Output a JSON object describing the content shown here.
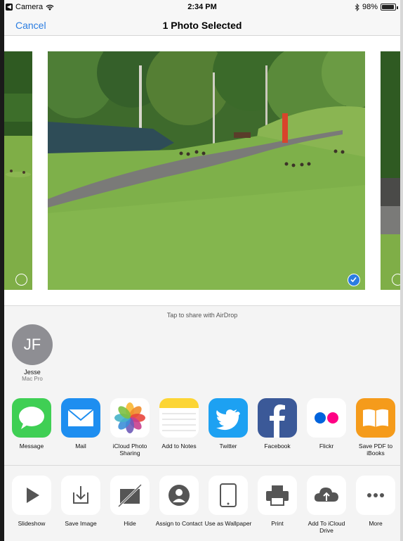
{
  "status": {
    "back_app": "Camera",
    "time": "2:34 PM",
    "battery": "98%",
    "battery_level": 0.98
  },
  "nav": {
    "cancel": "Cancel",
    "title": "1 Photo Selected"
  },
  "airdrop": {
    "hint": "Tap to share with AirDrop",
    "contact": {
      "initials": "JF",
      "name": "Jesse",
      "device": "Mac Pro"
    }
  },
  "apps": [
    {
      "label": "Message",
      "icon": "messages-icon"
    },
    {
      "label": "Mail",
      "icon": "mail-icon"
    },
    {
      "label": "iCloud Photo Sharing",
      "icon": "photos-icon"
    },
    {
      "label": "Add to Notes",
      "icon": "notes-icon"
    },
    {
      "label": "Twitter",
      "icon": "twitter-icon"
    },
    {
      "label": "Facebook",
      "icon": "facebook-icon"
    },
    {
      "label": "Flickr",
      "icon": "flickr-icon"
    },
    {
      "label": "Save PDF to iBooks",
      "icon": "ibooks-icon"
    }
  ],
  "actions": [
    {
      "label": "Slideshow",
      "icon": "play-icon"
    },
    {
      "label": "Save Image",
      "icon": "save-image-icon"
    },
    {
      "label": "Hide",
      "icon": "hide-icon"
    },
    {
      "label": "Assign to Contact",
      "icon": "contact-icon"
    },
    {
      "label": "Use as Wallpaper",
      "icon": "wallpaper-icon"
    },
    {
      "label": "Print",
      "icon": "print-icon"
    },
    {
      "label": "Add To iCloud Drive",
      "icon": "icloud-upload-icon"
    },
    {
      "label": "More",
      "icon": "more-icon"
    }
  ],
  "colors": {
    "accent": "#2b7de1",
    "messages": "#3fcf54",
    "mail": "#1e8ef0",
    "twitter": "#1da1f2",
    "facebook": "#3b5998",
    "flickr_blue": "#0063dc",
    "flickr_pink": "#ff0084",
    "ibooks": "#f59b1b"
  }
}
